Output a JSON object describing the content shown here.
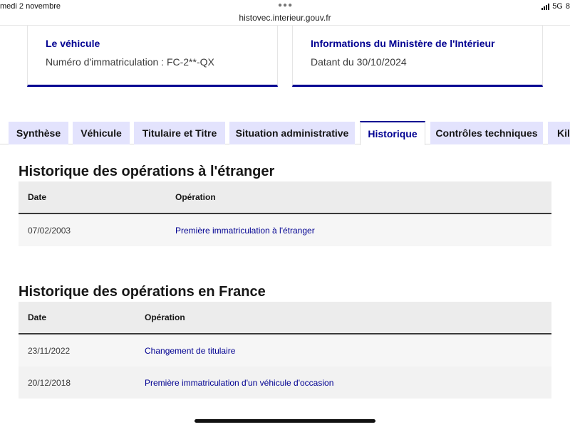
{
  "status_bar": {
    "date": "medi 2 novembre",
    "url": "histovec.interieur.gouv.fr",
    "network": "5G",
    "battery_fragment": "8"
  },
  "cards": [
    {
      "title": "Le véhicule",
      "value": "Numéro d'immatriculation : FC-2**-QX"
    },
    {
      "title": "Informations du Ministère de l'Intérieur",
      "value": "Datant du 30/10/2024"
    }
  ],
  "tabs": [
    {
      "label": "Synthèse",
      "active": false
    },
    {
      "label": "Véhicule",
      "active": false
    },
    {
      "label": "Titulaire et Titre",
      "active": false
    },
    {
      "label": "Situation administrative",
      "active": false
    },
    {
      "label": "Historique",
      "active": true
    },
    {
      "label": "Contrôles techniques",
      "active": false
    },
    {
      "label": "Kilo",
      "active": false
    }
  ],
  "foreign_history": {
    "title": "Historique des opérations à l'étranger",
    "headers": {
      "date": "Date",
      "operation": "Opération"
    },
    "rows": [
      {
        "date": "07/02/2003",
        "operation": "Première immatriculation à l'étranger"
      }
    ]
  },
  "france_history": {
    "title": "Historique des opérations en France",
    "headers": {
      "date": "Date",
      "operation": "Opération"
    },
    "rows": [
      {
        "date": "23/11/2022",
        "operation": "Changement de titulaire"
      },
      {
        "date": "20/12/2018",
        "operation": "Première immatriculation d'un véhicule d'occasion"
      }
    ]
  },
  "colors": {
    "accent": "#000091",
    "tab_bg": "#e3e3fd",
    "header_bg": "#ececec",
    "stripe_bg": "#f6f6f6"
  }
}
